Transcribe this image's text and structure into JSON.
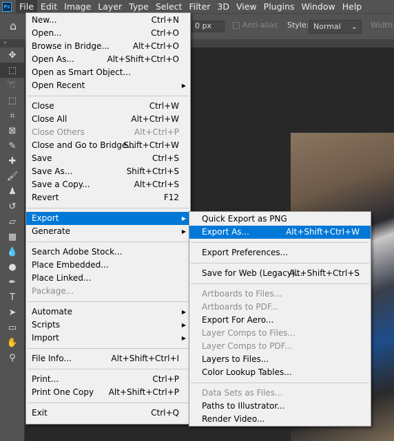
{
  "menubar": {
    "logo": "Ps",
    "items": [
      "File",
      "Edit",
      "Image",
      "Layer",
      "Type",
      "Select",
      "Filter",
      "3D",
      "View",
      "Plugins",
      "Window",
      "Help"
    ]
  },
  "options": {
    "feather_value": "0 px",
    "anti_alias": "Anti-alias",
    "style_label": "Style:",
    "style_value": "Normal",
    "width_label": "Width:"
  },
  "file_menu": [
    {
      "label": "New...",
      "shortcut": "Ctrl+N"
    },
    {
      "label": "Open...",
      "shortcut": "Ctrl+O"
    },
    {
      "label": "Browse in Bridge...",
      "shortcut": "Alt+Ctrl+O"
    },
    {
      "label": "Open As...",
      "shortcut": "Alt+Shift+Ctrl+O"
    },
    {
      "label": "Open as Smart Object..."
    },
    {
      "label": "Open Recent",
      "submenu": true
    },
    {
      "sep": true
    },
    {
      "label": "Close",
      "shortcut": "Ctrl+W"
    },
    {
      "label": "Close All",
      "shortcut": "Alt+Ctrl+W"
    },
    {
      "label": "Close Others",
      "shortcut": "Alt+Ctrl+P",
      "disabled": true
    },
    {
      "label": "Close and Go to Bridge...",
      "shortcut": "Shift+Ctrl+W"
    },
    {
      "label": "Save",
      "shortcut": "Ctrl+S"
    },
    {
      "label": "Save As...",
      "shortcut": "Shift+Ctrl+S"
    },
    {
      "label": "Save a Copy...",
      "shortcut": "Alt+Ctrl+S"
    },
    {
      "label": "Revert",
      "shortcut": "F12"
    },
    {
      "sep": true
    },
    {
      "label": "Export",
      "submenu": true,
      "highlighted": true
    },
    {
      "label": "Generate",
      "submenu": true
    },
    {
      "sep": true
    },
    {
      "label": "Search Adobe Stock..."
    },
    {
      "label": "Place Embedded..."
    },
    {
      "label": "Place Linked..."
    },
    {
      "label": "Package...",
      "disabled": true
    },
    {
      "sep": true
    },
    {
      "label": "Automate",
      "submenu": true
    },
    {
      "label": "Scripts",
      "submenu": true
    },
    {
      "label": "Import",
      "submenu": true
    },
    {
      "sep": true
    },
    {
      "label": "File Info...",
      "shortcut": "Alt+Shift+Ctrl+I"
    },
    {
      "sep": true
    },
    {
      "label": "Print...",
      "shortcut": "Ctrl+P"
    },
    {
      "label": "Print One Copy",
      "shortcut": "Alt+Shift+Ctrl+P"
    },
    {
      "sep": true
    },
    {
      "label": "Exit",
      "shortcut": "Ctrl+Q"
    }
  ],
  "export_menu": [
    {
      "label": "Quick Export as PNG"
    },
    {
      "label": "Export As...",
      "shortcut": "Alt+Shift+Ctrl+W",
      "highlighted": true
    },
    {
      "sep": true
    },
    {
      "label": "Export Preferences..."
    },
    {
      "sep": true
    },
    {
      "label": "Save for Web (Legacy)...",
      "shortcut": "Alt+Shift+Ctrl+S"
    },
    {
      "sep": true
    },
    {
      "label": "Artboards to Files...",
      "disabled": true
    },
    {
      "label": "Artboards to PDF...",
      "disabled": true
    },
    {
      "label": "Export For Aero..."
    },
    {
      "label": "Layer Comps to Files...",
      "disabled": true
    },
    {
      "label": "Layer Comps to PDF...",
      "disabled": true
    },
    {
      "label": "Layers to Files..."
    },
    {
      "label": "Color Lookup Tables..."
    },
    {
      "sep": true
    },
    {
      "label": "Data Sets as Files...",
      "disabled": true
    },
    {
      "label": "Paths to Illustrator..."
    },
    {
      "label": "Render Video..."
    }
  ],
  "colors": {
    "highlight": "#0078d7",
    "menu_bg": "#f0f0f0",
    "app_bg": "#535353"
  },
  "tools": [
    "move-icon",
    "marquee-icon",
    "lasso-icon",
    "object-select-icon",
    "crop-icon",
    "frame-icon",
    "eyedropper-icon",
    "healing-icon",
    "brush-icon",
    "stamp-icon",
    "history-brush-icon",
    "eraser-icon",
    "gradient-icon",
    "blur-icon",
    "dodge-icon",
    "pen-icon",
    "type-icon",
    "path-select-icon",
    "rectangle-icon",
    "hand-icon",
    "zoom-icon"
  ]
}
